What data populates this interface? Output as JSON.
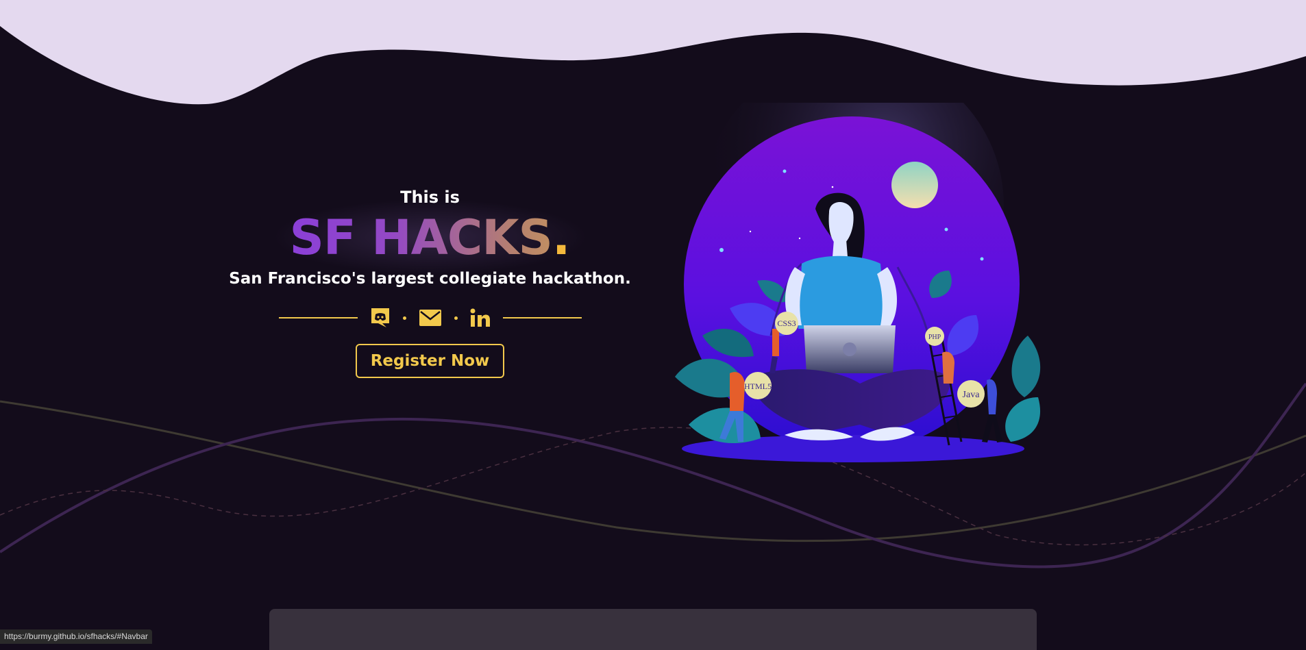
{
  "hero": {
    "intro": "This is",
    "title": "SF HACKS",
    "title_dot": ".",
    "subtitle": "San Francisco's largest collegiate hackathon.",
    "register_label": "Register Now"
  },
  "social": [
    {
      "name": "discord",
      "icon": "discord-icon"
    },
    {
      "name": "email",
      "icon": "mail-icon"
    },
    {
      "name": "linkedin",
      "icon": "linkedin-icon"
    }
  ],
  "illustration": {
    "tags": [
      "CSS3",
      "PHP",
      "HTML5",
      "Java"
    ]
  },
  "status_bar": {
    "url": "https://burmy.github.io/sfhacks/#Navbar"
  },
  "colors": {
    "background": "#130c1b",
    "top_wave": "#e4d9ef",
    "accent": "#f2c94c",
    "title_start": "#8b3fd8",
    "title_end": "#c28f62"
  }
}
